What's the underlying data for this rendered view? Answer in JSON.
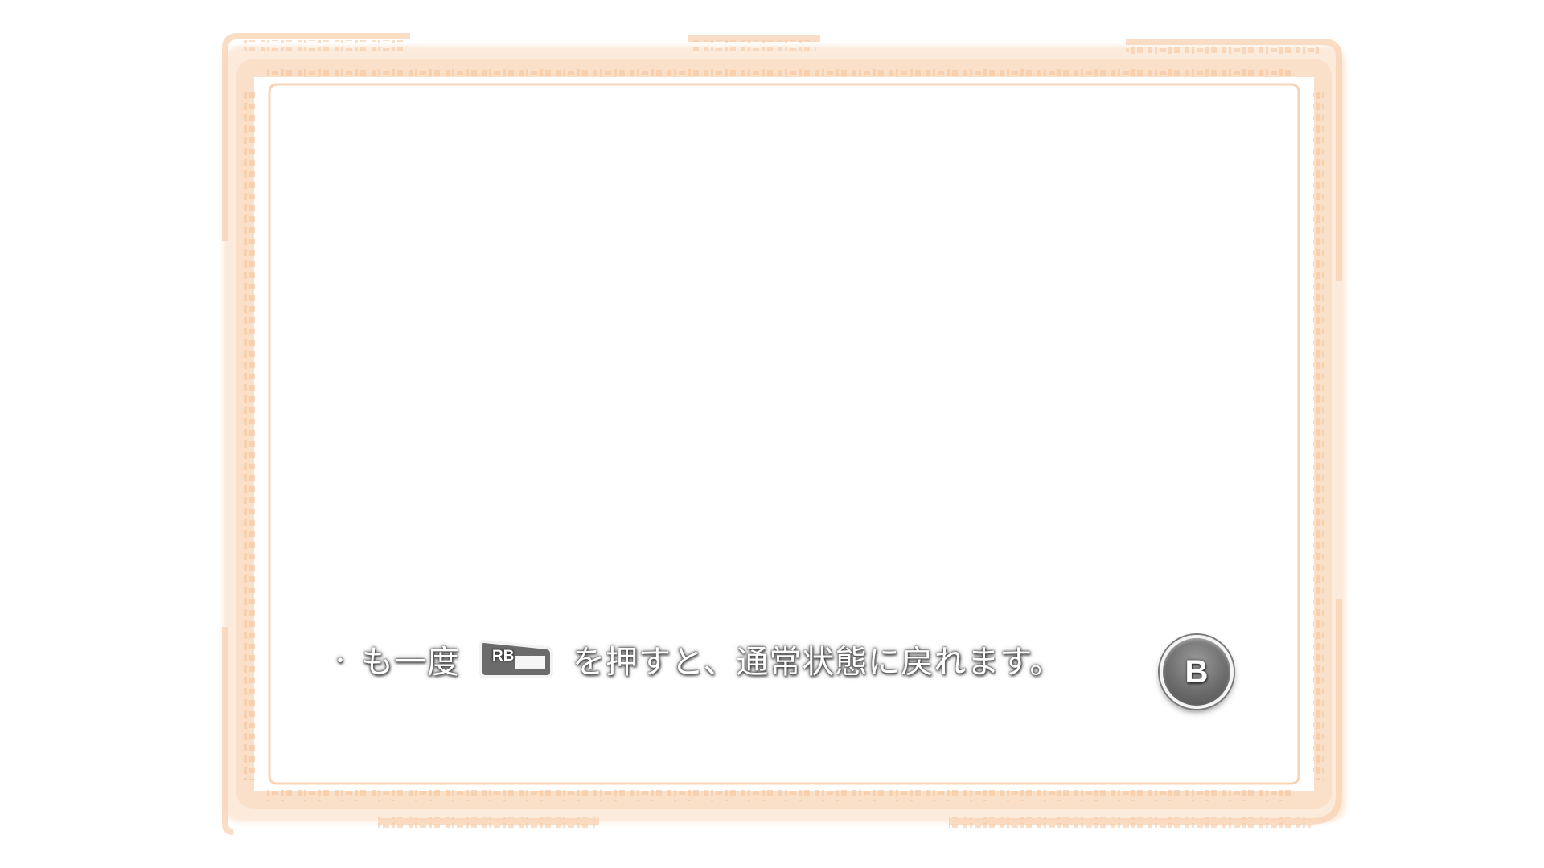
{
  "hint": {
    "bullet": "・",
    "text_before": "も一度",
    "button_label": "RB",
    "text_after": "を押すと、通常状態に戻れます。"
  },
  "back_button": {
    "label": "B",
    "icon": "b-button-icon"
  },
  "colors": {
    "frame_glow": "#fbe3cf",
    "frame_line": "#f6c9a4",
    "background": "#ffffff",
    "button_gray": "#6c6c6c"
  }
}
